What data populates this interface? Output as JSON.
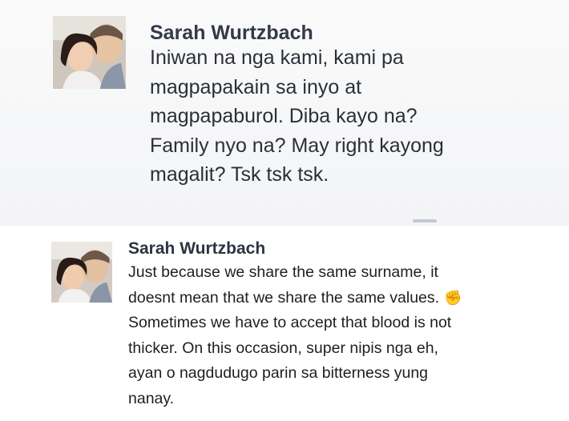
{
  "comments": [
    {
      "author": "Sarah Wurtzbach",
      "lines": [
        "Iniwan na nga kami, kami pa",
        "magpapakain sa inyo at",
        "magpapaburol. Diba kayo na?",
        "Family nyo na? May right kayong",
        "magalit? Tsk tsk tsk."
      ]
    },
    {
      "author": "Sarah Wurtzbach",
      "lines": [
        "Just because we share the same surname, it",
        "doesnt mean that we share the same values.",
        "Sometimes we have to accept that blood is not",
        "thicker. On this occasion, super nipis nga eh,",
        "ayan o nagdudugo parin sa bitterness yung",
        "nanay."
      ],
      "emoji": "✊"
    }
  ],
  "icons": {
    "avatar": "profile-photo",
    "emoji": "raised-fist-emoji"
  }
}
